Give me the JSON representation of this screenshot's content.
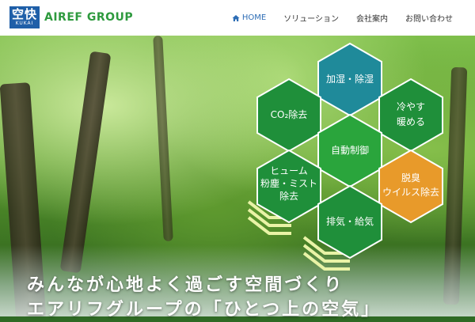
{
  "logo": {
    "mark_text": "空快",
    "mark_sub": "KUKAI",
    "text": "AIREF GROUP"
  },
  "nav": [
    {
      "label": "HOME",
      "active": true
    },
    {
      "label": "ソリューション"
    },
    {
      "label": "会社案内"
    },
    {
      "label": "お問い合わせ"
    }
  ],
  "hexes": [
    {
      "id": "humidify",
      "lines": [
        "加湿・除湿"
      ],
      "color": "#1f8a9a"
    },
    {
      "id": "co2",
      "lines": [
        "CO₂除去"
      ],
      "color": "#1f8f3a"
    },
    {
      "id": "cool-warm",
      "lines": [
        "冷やす",
        "暖める"
      ],
      "color": "#1f8f3a"
    },
    {
      "id": "auto-control",
      "lines": [
        "自動制御"
      ],
      "color": "#2aa53c"
    },
    {
      "id": "fume",
      "lines": [
        "ヒューム",
        "粉塵・ミスト",
        "除去"
      ],
      "color": "#1f8f3a"
    },
    {
      "id": "deodorize",
      "lines": [
        "脱臭",
        "ウイルス除去"
      ],
      "color": "#e89a2a"
    },
    {
      "id": "exhaust",
      "lines": [
        "排気・給気"
      ],
      "color": "#1f8f3a"
    }
  ],
  "tagline": {
    "line1": "みんなが心地よく過ごす空間づくり",
    "line2": "エアリフグループの「ひとつ上の空気」"
  }
}
